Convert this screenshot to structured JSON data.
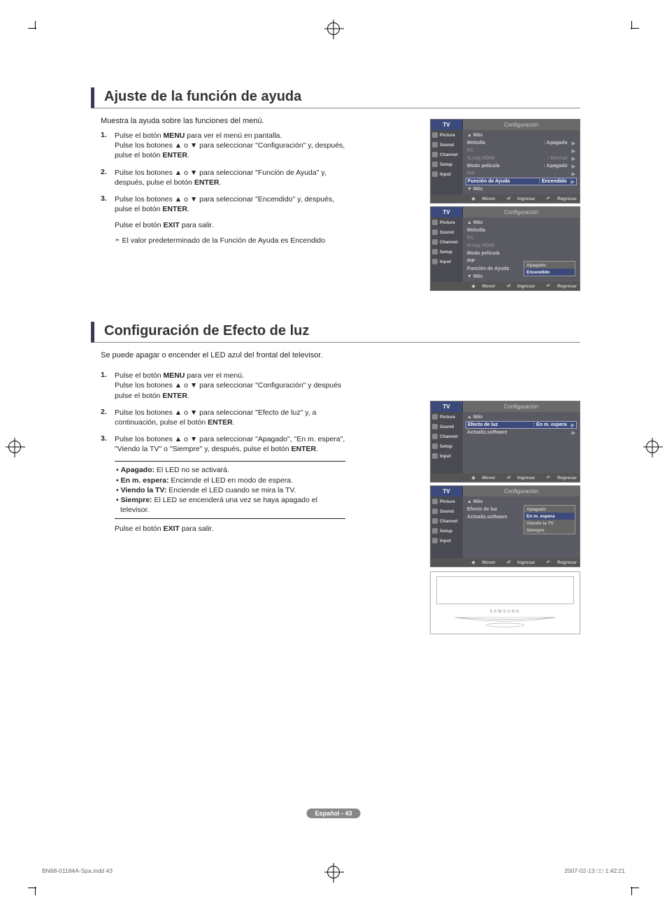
{
  "page": {
    "label": "Español - 43",
    "footer_left": "BN68-01184A-Spa.indd   43",
    "footer_right": "2007-02-13   □□ 1:42:21"
  },
  "s1": {
    "title": "Ajuste de la función de ayuda",
    "intro": "Muestra la ayuda sobre las funciones del menú.",
    "step1": "Pulse el botón MENU para ver el menú en pantalla.\nPulse los botones ▲ o ▼ para seleccionar \"Configuración\" y, después, pulse el botón ENTER.",
    "step2": "Pulse los botones ▲ o ▼ para seleccionar \"Función de Ayuda\" y, después, pulse el botón ENTER.",
    "step3": "Pulse los botones ▲ o ▼ para seleccionar \"Encendido\" y, después, pulse el botón ENTER.",
    "exit": "Pulse el botón EXIT para salir.",
    "note": "El valor predeterminado de la Función de Ayuda es Encendido"
  },
  "s2": {
    "title": "Configuración de Efecto de luz",
    "intro": "Se puede apagar o encender el LED azul del frontal del televisor.",
    "step1": "Pulse el botón MENU para ver el menú.\nPulse los botones ▲ o ▼ para seleccionar \"Configuración\" y después pulse el botón ENTER.",
    "step2": "Pulse los botones ▲ o ▼ para seleccionar \"Efecto de luz\" y, a continuación, pulse el botón ENTER.",
    "step3": "Pulse los botones ▲ o ▼ para seleccionar \"Apagado\", \"En m. espera\", \"Viendo la TV\" o \"Siempre\" y, después, pulse el botón ENTER.",
    "opt1": "Apagado: El LED no se activará.",
    "opt2": "En m. espera: Enciende el LED en modo de espera.",
    "opt3": "Viendo la TV: Enciende el LED cuando se mira la TV.",
    "opt4": "Siempre: El LED se encenderá una vez se haya apagado el televisor.",
    "exit": "Pulse el botón EXIT para salir."
  },
  "osd": {
    "tv": "TV",
    "title": "Configuración",
    "side": [
      "Picture",
      "Sound",
      "Channel",
      "Setup",
      "Input"
    ],
    "footer": {
      "move": "Mover",
      "enter": "Ingresar",
      "return": "Regresar"
    },
    "a1": {
      "more_up": "▲ Más",
      "rows": [
        {
          "lab": "Melodía",
          "val": ": Apagado",
          "arrow": "▶"
        },
        {
          "lab": "PC",
          "val": "",
          "arrow": "▶",
          "dim": true
        },
        {
          "lab": "N.neg HDMI",
          "val": ": Normal",
          "arrow": "▶",
          "dim": true
        },
        {
          "lab": "Modo película",
          "val": ": Apagado",
          "arrow": "▶"
        },
        {
          "lab": "PIP",
          "val": "",
          "arrow": "▶",
          "dim": true
        },
        {
          "lab": "Función de Ayuda",
          "val": ": Encendido",
          "arrow": "▶",
          "hl": true
        }
      ],
      "more_dn": "▼ Más"
    },
    "a2": {
      "more_up": "▲ Más",
      "rows": [
        {
          "lab": "Melodía"
        },
        {
          "lab": "PC",
          "dim": true
        },
        {
          "lab": "N.neg HDMI",
          "dim": true
        },
        {
          "lab": "Modo película"
        },
        {
          "lab": "PIP"
        },
        {
          "lab": "Función de Ayuda"
        }
      ],
      "more_dn": "▼ Más",
      "popup": [
        "Apagado",
        "Encendido"
      ],
      "popup_sel": 1
    },
    "b1": {
      "more_up": "▲ Más",
      "rows": [
        {
          "lab": "Efecto de luz",
          "val": ": En m. espera",
          "arrow": "▶",
          "hl": true
        },
        {
          "lab": "Actualiz.software",
          "val": "",
          "arrow": "▶"
        }
      ]
    },
    "b2": {
      "more_up": "▲ Más",
      "rows": [
        {
          "lab": "Efecto de luz"
        },
        {
          "lab": "Actualiz.software"
        }
      ],
      "popup": [
        "Apagado",
        "En m. espera",
        "Viendo la TV",
        "Siempre"
      ],
      "popup_sel": 1
    }
  },
  "tv_brand": "SAMSUNG"
}
